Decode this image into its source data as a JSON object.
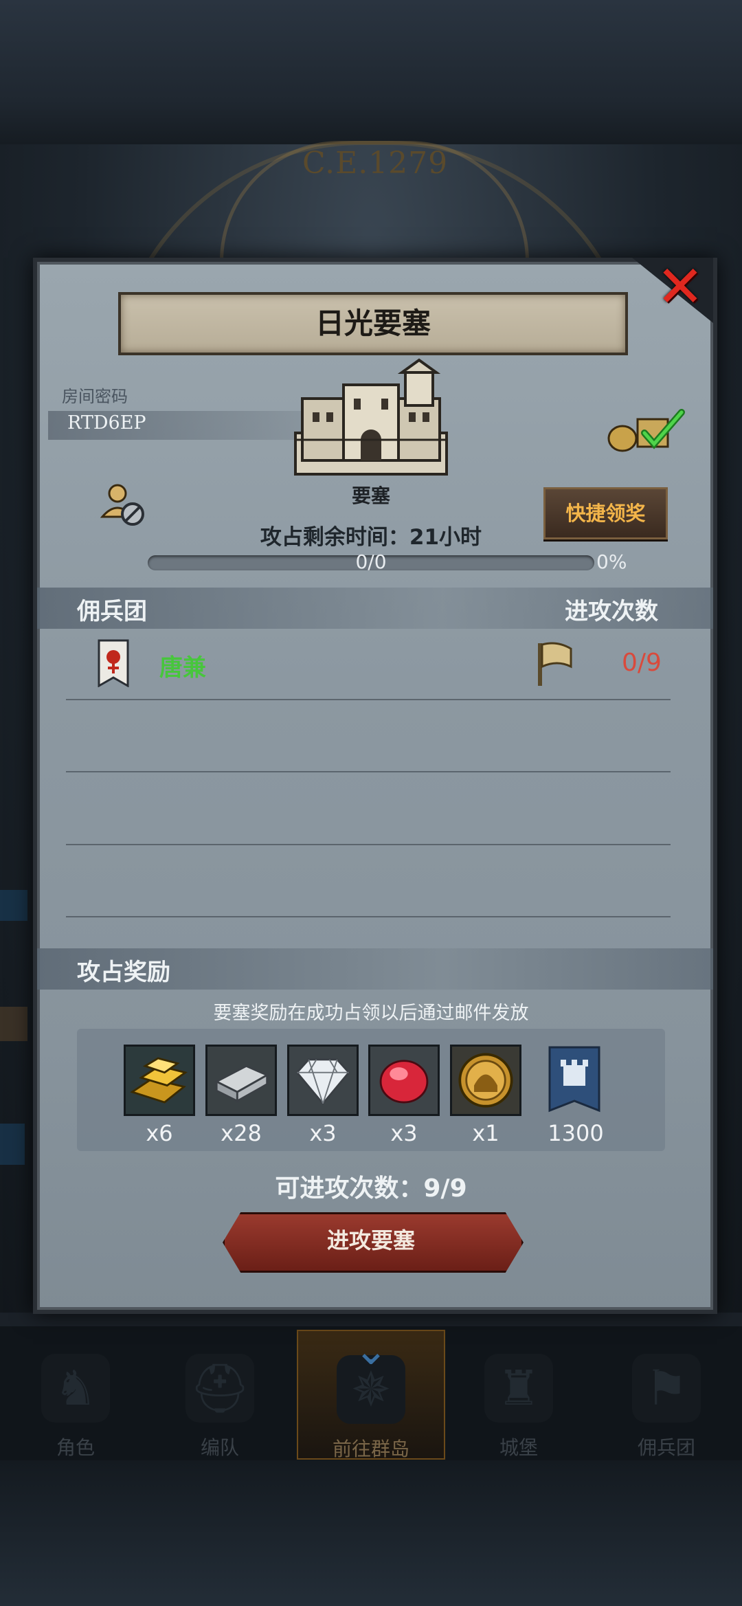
{
  "background": {
    "year_label": "C.E.1279"
  },
  "modal": {
    "title": "日光要塞",
    "close_icon": "close-x-icon",
    "room_code_label": "房间密码",
    "room_code": "RTD6EP",
    "fortress_type": "要塞",
    "quick_claim_label": "快捷领奖",
    "timer_label": "攻占剩余时间：",
    "timer_value": "21小时",
    "progress_text": "0/0",
    "progress_percent": "0%",
    "progress_value": 0,
    "section_mercenary": "佣兵团",
    "section_attack_count": "进攻次数",
    "mercenary": {
      "name": "唐兼",
      "attack_count": "0/9"
    },
    "reward_section_title": "攻占奖励",
    "reward_note": "要塞奖励在成功占领以后通过邮件发放",
    "rewards": [
      {
        "icon": "gold-bar-icon",
        "qty": "x6"
      },
      {
        "icon": "silver-bar-icon",
        "qty": "x28"
      },
      {
        "icon": "diamond-icon",
        "qty": "x3"
      },
      {
        "icon": "ruby-icon",
        "qty": "x3"
      },
      {
        "icon": "gold-medal-icon",
        "qty": "x1"
      },
      {
        "icon": "castle-banner-icon",
        "qty": "1300"
      }
    ],
    "attempts_label": "可进攻次数：9/9",
    "attack_button": "进攻要塞"
  },
  "tabbar": {
    "tabs": [
      {
        "label": "角色",
        "icon": "knight-icon"
      },
      {
        "label": "编队",
        "icon": "helmet-icon"
      },
      {
        "label": "前往群岛",
        "icon": "compass-icon"
      },
      {
        "label": "城堡",
        "icon": "castle-icon"
      },
      {
        "label": "佣兵团",
        "icon": "mercenary-icon"
      }
    ],
    "active_index": 2
  },
  "colors": {
    "accent_gold": "#f3b54a",
    "mercenary_green": "#47c63c",
    "count_red": "#d94a3c",
    "close_red": "#e0281f"
  }
}
